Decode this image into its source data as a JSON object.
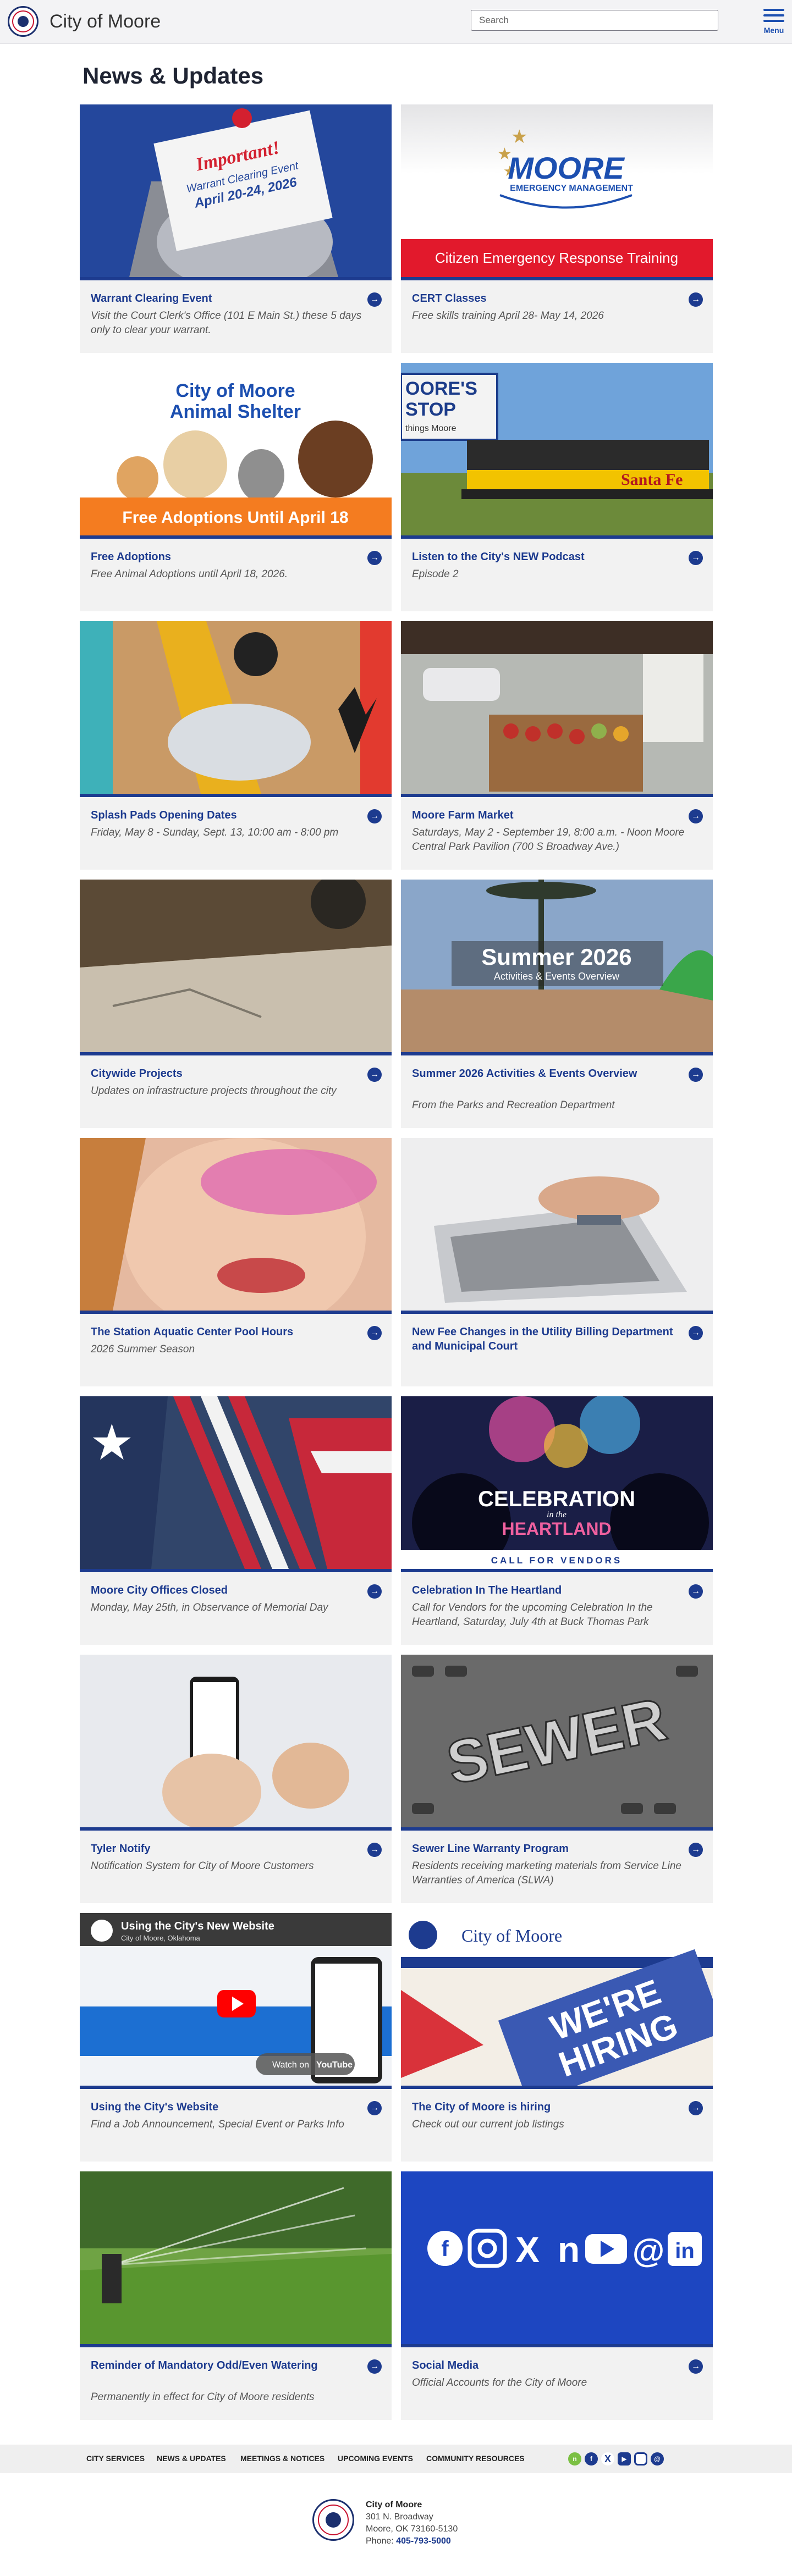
{
  "header": {
    "site_name": "City of Moore",
    "search_placeholder": "Search",
    "menu_label": "Menu"
  },
  "page_title": "News & Updates",
  "image_text": {
    "important": "Important!",
    "warrant_line1": "Warrant Clearing Event",
    "warrant_line2": "April 20-24, 2026",
    "moore_logo": "MOORE",
    "moore_logo_sub": "EMERGENCY MANAGEMENT",
    "cert_banner": "Citizen Emergency Response Training",
    "shelter_line1": "City of Moore",
    "shelter_line2": "Animal Shelter",
    "shelter_banner": "Free Adoptions Until April 18",
    "podcast_sign1": "OORE'S",
    "podcast_sign2": "STOP",
    "podcast_sign3": "things Moore",
    "train_text": "Santa Fe",
    "summer_big": "Summer 2026",
    "summer_small": "Activities & Events Overview",
    "celebration_1": "CELEBRATION",
    "celebration_2": "HEARTLAND",
    "celebration_in": "in the",
    "vendors_band": "CALL FOR VENDORS",
    "sewer_text": "SEWER",
    "video_title": "Using the City's New Website",
    "video_channel": "City of Moore, Oklahoma",
    "video_watch": "Watch on",
    "video_yt": "YouTube",
    "hiring_org": "City of Moore",
    "hiring_big1": "WE'RE",
    "hiring_big2": "HIRING"
  },
  "cards": [
    {
      "title": "Warrant Clearing Event",
      "subtitle": "Visit the Court Clerk's Office (101 E Main St.) these 5 days only to clear your warrant."
    },
    {
      "title": "CERT Classes",
      "subtitle": "Free skills training April 28- May 14, 2026"
    },
    {
      "title": "Free Adoptions",
      "subtitle": "Free Animal Adoptions until April 18, 2026."
    },
    {
      "title": "Listen to the City's NEW Podcast",
      "subtitle": "Episode 2"
    },
    {
      "title": "Splash Pads Opening Dates",
      "subtitle": "Friday, May 8 - Sunday, Sept. 13, 10:00 am - 8:00 pm"
    },
    {
      "title": "Moore Farm Market",
      "subtitle": "Saturdays, May 2 - September 19, 8:00 a.m. - Noon Moore Central Park Pavilion (700 S Broadway Ave.)"
    },
    {
      "title": "Citywide Projects",
      "subtitle": "Updates on infrastructure projects throughout the city"
    },
    {
      "title": "Summer 2026 Activities & Events Overview",
      "subtitle": "From the Parks and Recreation Department"
    },
    {
      "title": "The Station Aquatic Center Pool Hours",
      "subtitle": "2026 Summer Season"
    },
    {
      "title": "New Fee Changes in the Utility Billing Department and Municipal Court",
      "subtitle": ""
    },
    {
      "title": "Moore City Offices Closed",
      "subtitle": "Monday, May 25th, in Observance of Memorial Day"
    },
    {
      "title": "Celebration In The Heartland",
      "subtitle": "Call for Vendors for the upcoming Celebration In the Heartland, Saturday, July 4th at Buck Thomas Park"
    },
    {
      "title": "Tyler Notify",
      "subtitle": "Notification System for City of Moore Customers"
    },
    {
      "title": "Sewer Line Warranty Program",
      "subtitle": "Residents receiving marketing materials from Service Line Warranties of America (SLWA)"
    },
    {
      "title": "Using the City's Website",
      "subtitle": "Find a Job Announcement, Special Event or Parks Info"
    },
    {
      "title": "The City of Moore is hiring",
      "subtitle": "Check out our current job listings"
    },
    {
      "title": "Reminder of Mandatory Odd/Even Watering",
      "subtitle": "Permanently in effect for City of Moore residents"
    },
    {
      "title": "Social Media",
      "subtitle": "Official Accounts for the City of Moore"
    }
  ],
  "footer": {
    "nav": [
      "CITY SERVICES",
      "NEWS & UPDATES",
      "MEETINGS & NOTICES",
      "UPCOMING EVENTS",
      "COMMUNITY RESOURCES"
    ],
    "org": "City of Moore",
    "street": "301 N. Broadway",
    "city": "Moore, OK 73160-5130",
    "phone_label": "Phone:",
    "phone": "405-793-5000"
  },
  "colors": {
    "brand_blue": "#1d3b8f",
    "red": "#e2192c",
    "orange": "#f47c20"
  }
}
